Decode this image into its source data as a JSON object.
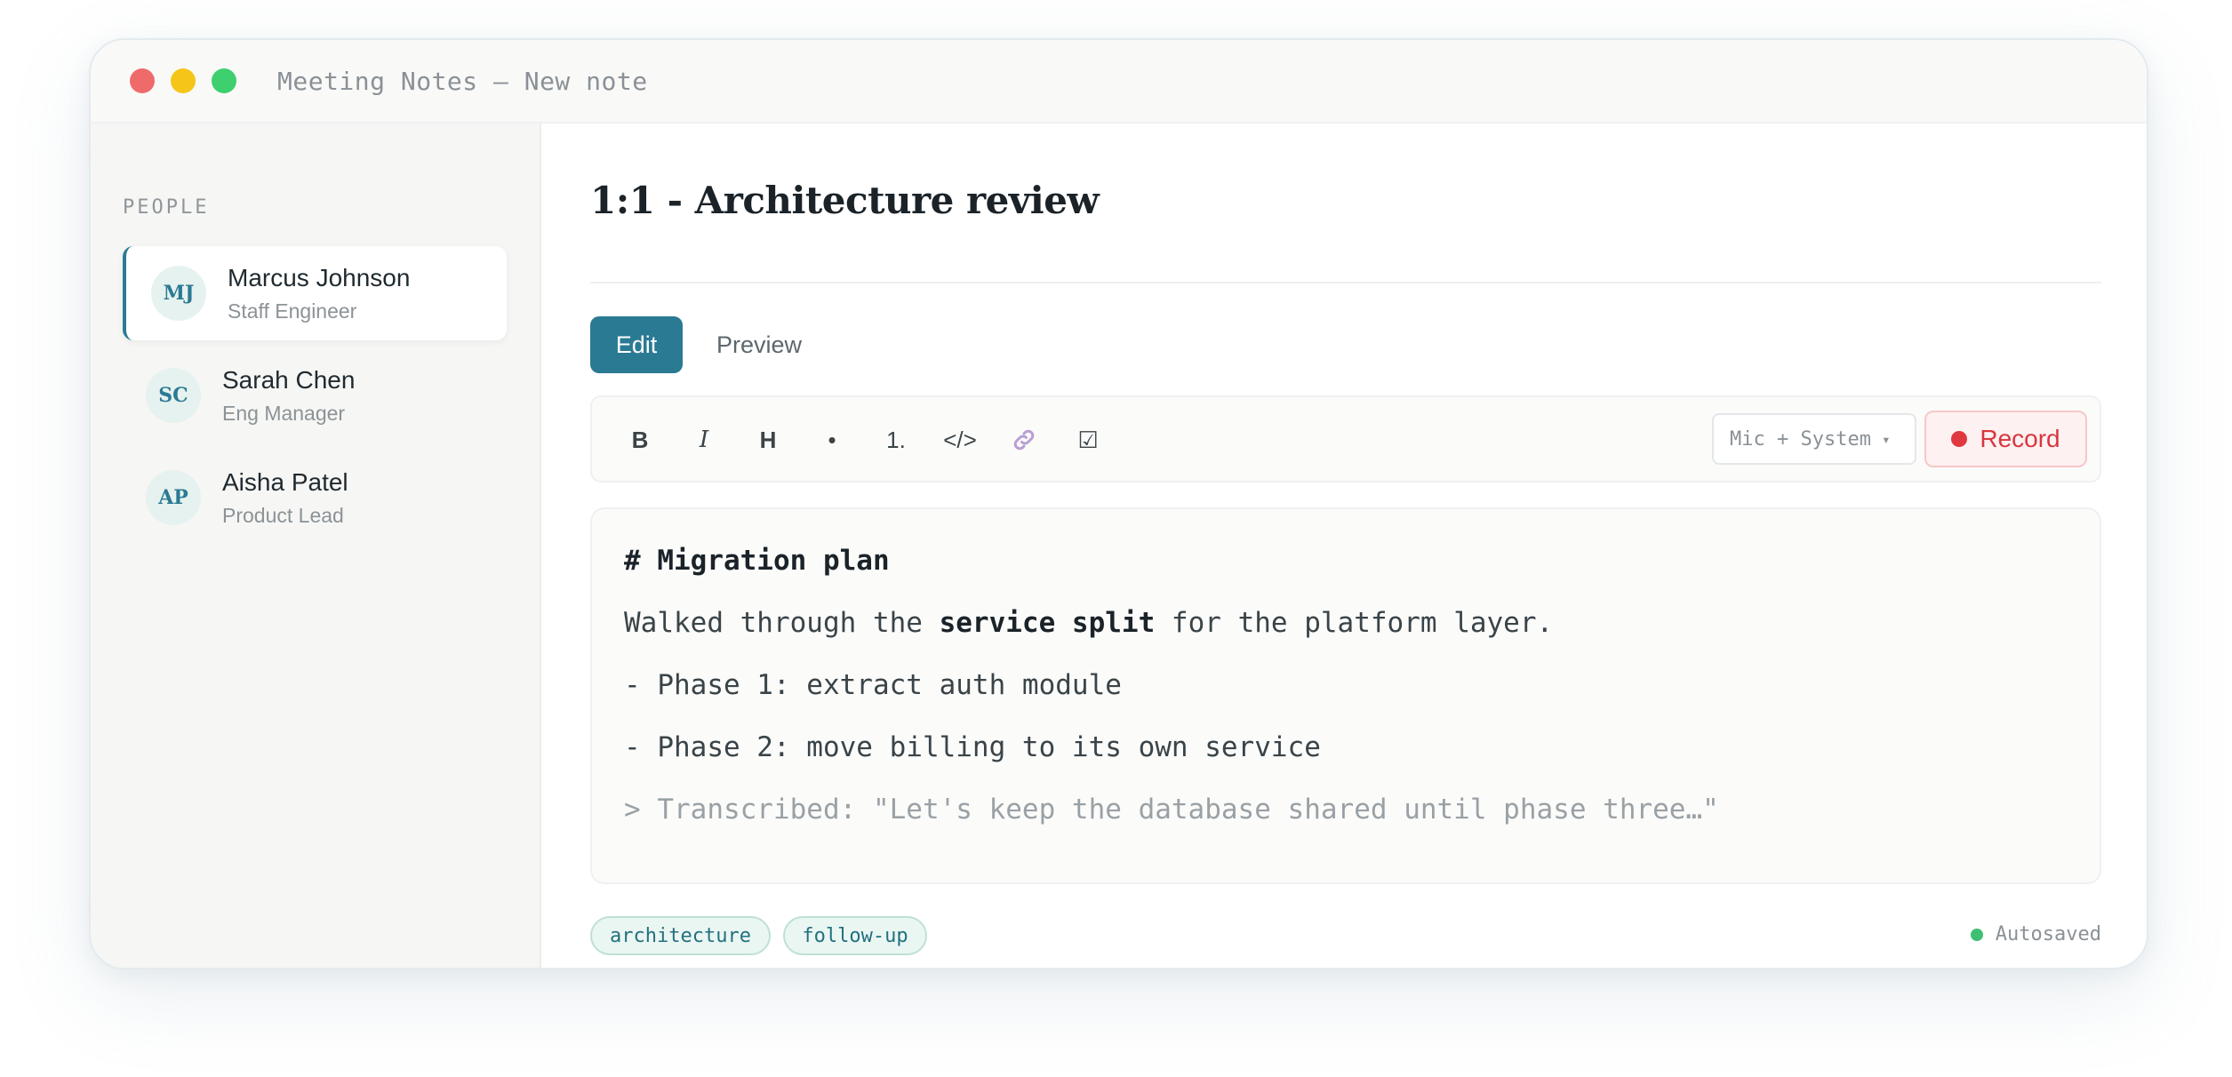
{
  "window": {
    "title": "Meeting Notes — New note"
  },
  "sidebar": {
    "heading": "PEOPLE",
    "people": [
      {
        "initials": "MJ",
        "name": "Marcus Johnson",
        "role": "Staff Engineer",
        "active": true
      },
      {
        "initials": "SC",
        "name": "Sarah Chen",
        "role": "Eng Manager",
        "active": false
      },
      {
        "initials": "AP",
        "name": "Aisha Patel",
        "role": "Product Lead",
        "active": false
      }
    ]
  },
  "note": {
    "title": "1:1 - Architecture review",
    "tabs": [
      {
        "label": "Edit",
        "selected": true
      },
      {
        "label": "Preview",
        "selected": false
      }
    ]
  },
  "toolbar": {
    "tools": [
      {
        "icon": "bold-icon",
        "glyph": "B"
      },
      {
        "icon": "italic-icon",
        "glyph": "I"
      },
      {
        "icon": "heading-icon",
        "glyph": "H"
      },
      {
        "icon": "bullet-list-icon",
        "glyph": "•"
      },
      {
        "icon": "numbered-list-icon",
        "glyph": "1."
      },
      {
        "icon": "code-icon",
        "glyph": "</>"
      },
      {
        "icon": "link-icon",
        "glyph": "🔗"
      },
      {
        "icon": "checkbox-icon",
        "glyph": "☑"
      }
    ],
    "audio_source": "Mic + System",
    "record_label": "Record"
  },
  "editor": {
    "heading": "# Migration plan",
    "paragraph_before": "Walked through the ",
    "paragraph_bold": "service split",
    "paragraph_after": " for the platform layer.",
    "list_item_1": "- Phase 1: extract auth module",
    "list_item_2": "- Phase 2: move billing to its own service",
    "quote": "> Transcribed: \"Let's keep the database shared until phase three…\""
  },
  "footer": {
    "tags": [
      "architecture",
      "follow-up"
    ],
    "status": "Autosaved"
  },
  "colors": {
    "accent": "#2b7a94",
    "record": "#d9363e",
    "autosaved": "#3fbf72",
    "tag_bg": "#eaf6f2"
  }
}
